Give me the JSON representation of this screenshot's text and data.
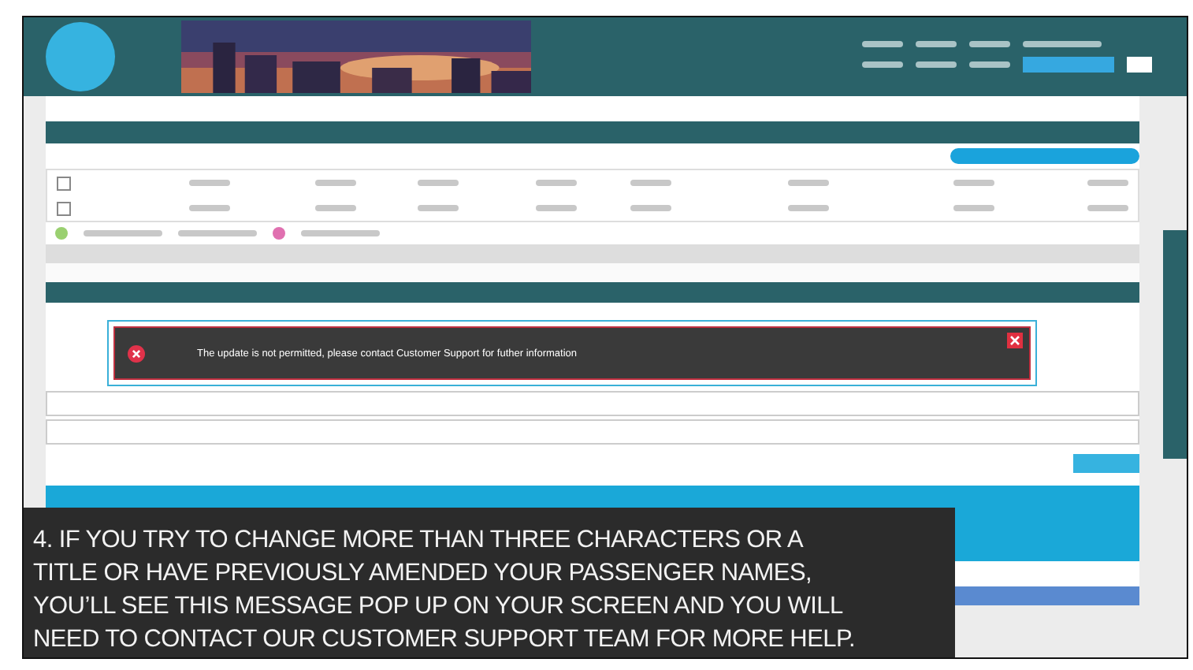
{
  "flights": [
    {
      "checked": false
    },
    {
      "checked": false
    }
  ],
  "alert": {
    "message": "The update is not permitted, please contact Customer Support for futher information"
  },
  "caption": {
    "lines": [
      "4. IF YOU TRY TO CHANGE MORE THAN THREE CHARACTERS OR A",
      "TITLE OR HAVE PREVIOUSLY AMENDED YOUR PASSENGER NAMES,",
      "YOU’LL SEE THIS MESSAGE POP UP ON YOUR SCREEN AND YOU WILL",
      "NEED TO CONTACT OUR CUSTOMER SUPPORT TEAM FOR  MORE HELP."
    ]
  }
}
